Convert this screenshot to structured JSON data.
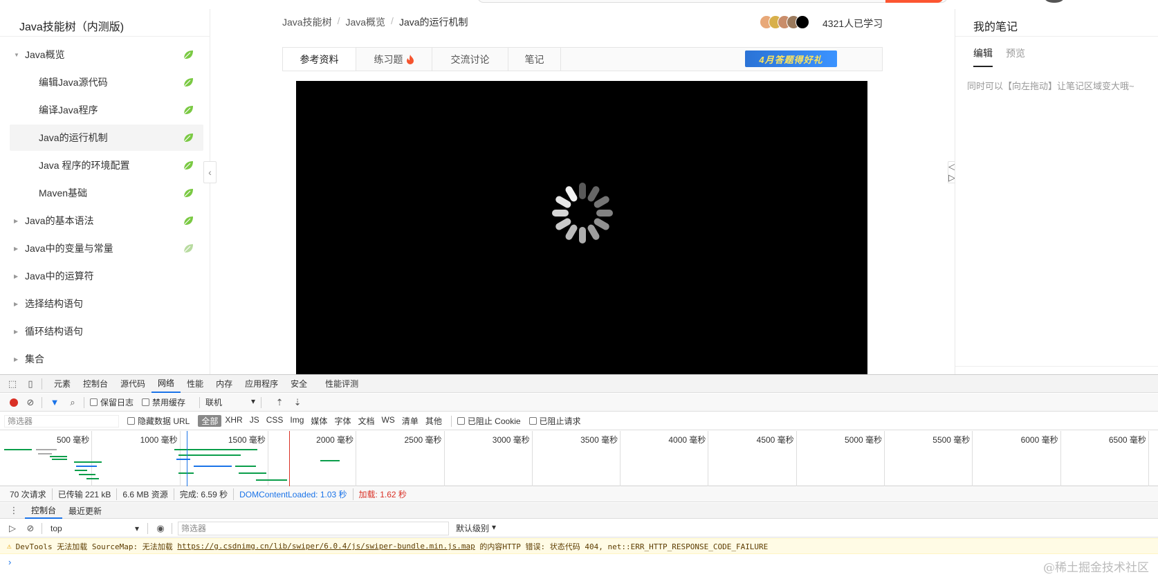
{
  "sidebar": {
    "title": "Java技能树（内测版)",
    "items": [
      {
        "label": "Java概览",
        "expanded": true,
        "child": false,
        "active": false,
        "leaf_state": "done"
      },
      {
        "label": "编辑Java源代码",
        "child": true,
        "active": false,
        "leaf_state": "done"
      },
      {
        "label": "编译Java程序",
        "child": true,
        "active": false,
        "leaf_state": "done"
      },
      {
        "label": "Java的运行机制",
        "child": true,
        "active": true,
        "leaf_state": "done"
      },
      {
        "label": "Java 程序的环境配置",
        "child": true,
        "active": false,
        "leaf_state": "done"
      },
      {
        "label": "Maven基础",
        "child": true,
        "active": false,
        "leaf_state": "done"
      },
      {
        "label": "Java的基本语法",
        "child": false,
        "active": false,
        "leaf_state": "done"
      },
      {
        "label": "Java中的变量与常量",
        "child": false,
        "active": false,
        "leaf_state": "partial"
      },
      {
        "label": "Java中的运算符",
        "child": false,
        "active": false,
        "leaf_state": "none"
      },
      {
        "label": "选择结构语句",
        "child": false,
        "active": false,
        "leaf_state": "none"
      },
      {
        "label": "循环结构语句",
        "child": false,
        "active": false,
        "leaf_state": "none"
      },
      {
        "label": "集合",
        "child": false,
        "active": false,
        "leaf_state": "none"
      }
    ]
  },
  "breadcrumb": {
    "items": [
      "Java技能树",
      "Java概览",
      "Java的运行机制"
    ],
    "separator": "/"
  },
  "learners": "4321人已学习",
  "tabs": [
    {
      "label": "参考资料",
      "active": true
    },
    {
      "label": "练习题",
      "active": false,
      "icon": "fire-icon"
    },
    {
      "label": "交流讨论",
      "active": false
    },
    {
      "label": "笔记",
      "active": false
    }
  ],
  "promo": {
    "text": "4月答题得好礼"
  },
  "notes": {
    "title": "我的笔记",
    "tab_edit": "编辑",
    "tab_preview": "预览",
    "hint": "同时可以【向左拖动】让笔记区域变大哦~"
  },
  "devtools": {
    "tabs": [
      "元素",
      "控制台",
      "源代码",
      "网络",
      "性能",
      "内存",
      "应用程序",
      "安全",
      "性能评测"
    ],
    "active_tab": "网络",
    "toolbar": {
      "preserve_log": "保留日志",
      "disable_cache": "禁用缓存",
      "throttle": "联机"
    },
    "filter": {
      "placeholder": "筛选器",
      "hide_data_url": "隐藏数据 URL",
      "types": [
        "全部",
        "XHR",
        "JS",
        "CSS",
        "Img",
        "媒体",
        "字体",
        "文档",
        "WS",
        "清单",
        "其他"
      ],
      "active_type": "全部",
      "blocked_cookies": "已阻止 Cookie",
      "blocked_requests": "已阻止请求"
    },
    "timeline_labels": [
      "500 毫秒",
      "1000 毫秒",
      "1500 毫秒",
      "2000 毫秒",
      "2500 毫秒",
      "3000 毫秒",
      "3500 毫秒",
      "4000 毫秒",
      "4500 毫秒",
      "5000 毫秒",
      "5500 毫秒",
      "6000 毫秒",
      "6500 毫秒"
    ],
    "summary": {
      "requests": "70 次请求",
      "transferred": "已传输 221 kB",
      "resources": "6.6 MB 资源",
      "finish": "完成: 6.59 秒",
      "dcl": "DOMContentLoaded: 1.03 秒",
      "load": "加载: 1.62 秒"
    },
    "drawer_tabs": [
      "控制台",
      "最近更新"
    ],
    "context": "top",
    "console_filter": "筛选器",
    "level": "默认级别",
    "warning": {
      "prefix": "DevTools 无法加载 SourceMap: 无法加载 ",
      "url": "https://g.csdnimg.cn/lib/swiper/6.0.4/js/swiper-bundle.min.js.map",
      "suffix": " 的内容HTTP 错误: 状态代码 404, net::ERR_HTTP_RESPONSE_CODE_FAILURE"
    },
    "prompt": "›"
  },
  "watermark": "@稀土掘金技术社区",
  "colors": {
    "leaf_green": "#7ac943",
    "video_bg": "#000000",
    "accent_blue": "#1a73e8",
    "record_red": "#d93025",
    "promo_blue": "#2b73d6"
  }
}
